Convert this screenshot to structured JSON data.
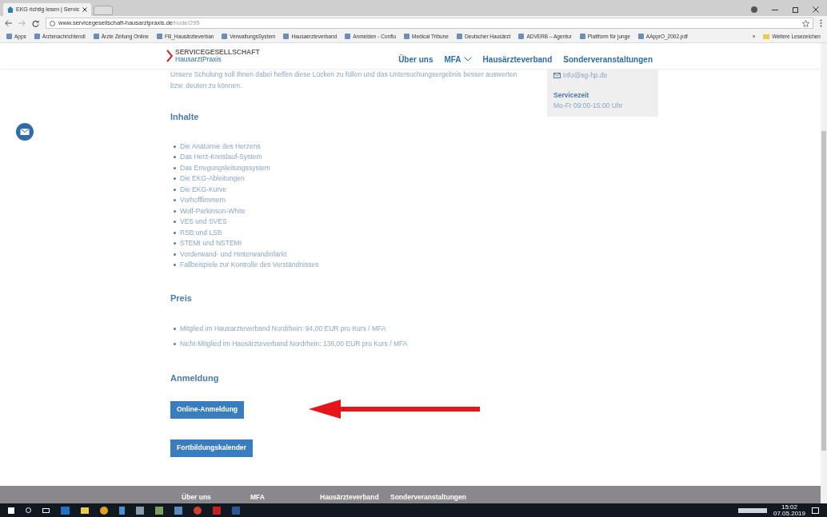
{
  "browser": {
    "tab_title": "EKG richtig lesen | Servic",
    "url_domain": "www.servicegesellschaft-hausarztpraxis.de",
    "url_path": "/node/295",
    "bookmarks": [
      "Apps",
      "Ärztenachrichtendi",
      "Ärzte Zeitung Online",
      "FB_Hausärzteverban",
      "VerwaltungsSystem",
      "Hausaerzteverband",
      "Anmelden - Conflu",
      "Medical Tribune",
      "Deutscher Hausärzt",
      "ADVERB – Agentur",
      "Plattform für junge",
      "AApprO_2002.pdf"
    ],
    "more": "»",
    "other_bookmarks": "Weitere Lesezeichen"
  },
  "site": {
    "logo_top": "SERVICEGESELLSCHAFT",
    "logo_bottom": "HausarztPraxis",
    "nav": [
      {
        "label": "Über uns",
        "dropdown": false
      },
      {
        "label": "MFA",
        "dropdown": true
      },
      {
        "label": "Hausärzteverband",
        "dropdown": false
      },
      {
        "label": "Sonderveranstaltungen",
        "dropdown": false
      }
    ]
  },
  "intro": "Unsere Schulung soll Ihnen dabei helfen diese Lücken zu füllen und das Untersuchungsergebnis besser auswerten bzw. deuten zu können.",
  "contact": {
    "email": "info@sg-hp.de",
    "hours_title": "Servicezeit",
    "hours": "Mo-Fr 09:00-15:00 Uhr"
  },
  "sections": [
    {
      "title": "Inhalte",
      "items": [
        "Die Anatomie des Herzens",
        "Das Herz-Kreislauf-System",
        "Das Erregungsleitungssystem",
        "Die EKG-Ableitungen",
        "Die EKG-Kurve",
        "Vorhofflimmern",
        "Wolf-Parkinson-White",
        "VES und SVES",
        "RSB und LSB",
        "STEMI und NSTEMI",
        "Vorderwand- und Hinterwandinfarkt",
        "Fallbeispiele zur Kontrolle des Verständnisses"
      ]
    },
    {
      "title": "Preis",
      "items": [
        "Mitglied im Hausarzteverband Nordrhein: 94,00 EUR pro Kurs / MFA",
        "Nicht-Mitglied im Hausärzteverband Nordrhein: 136,00 EUR pro Kurs / MFA"
      ]
    }
  ],
  "registration": {
    "title": "Anmeldung",
    "buttons": [
      "Online-Anmeldung",
      "Fortbildungskalender"
    ]
  },
  "footer_nav": [
    "Über uns",
    "MFA",
    "Hausärzteverband",
    "Sonderveranstaltungen"
  ],
  "taskbar": {
    "time": "15:02",
    "date": "07.05.2019"
  }
}
